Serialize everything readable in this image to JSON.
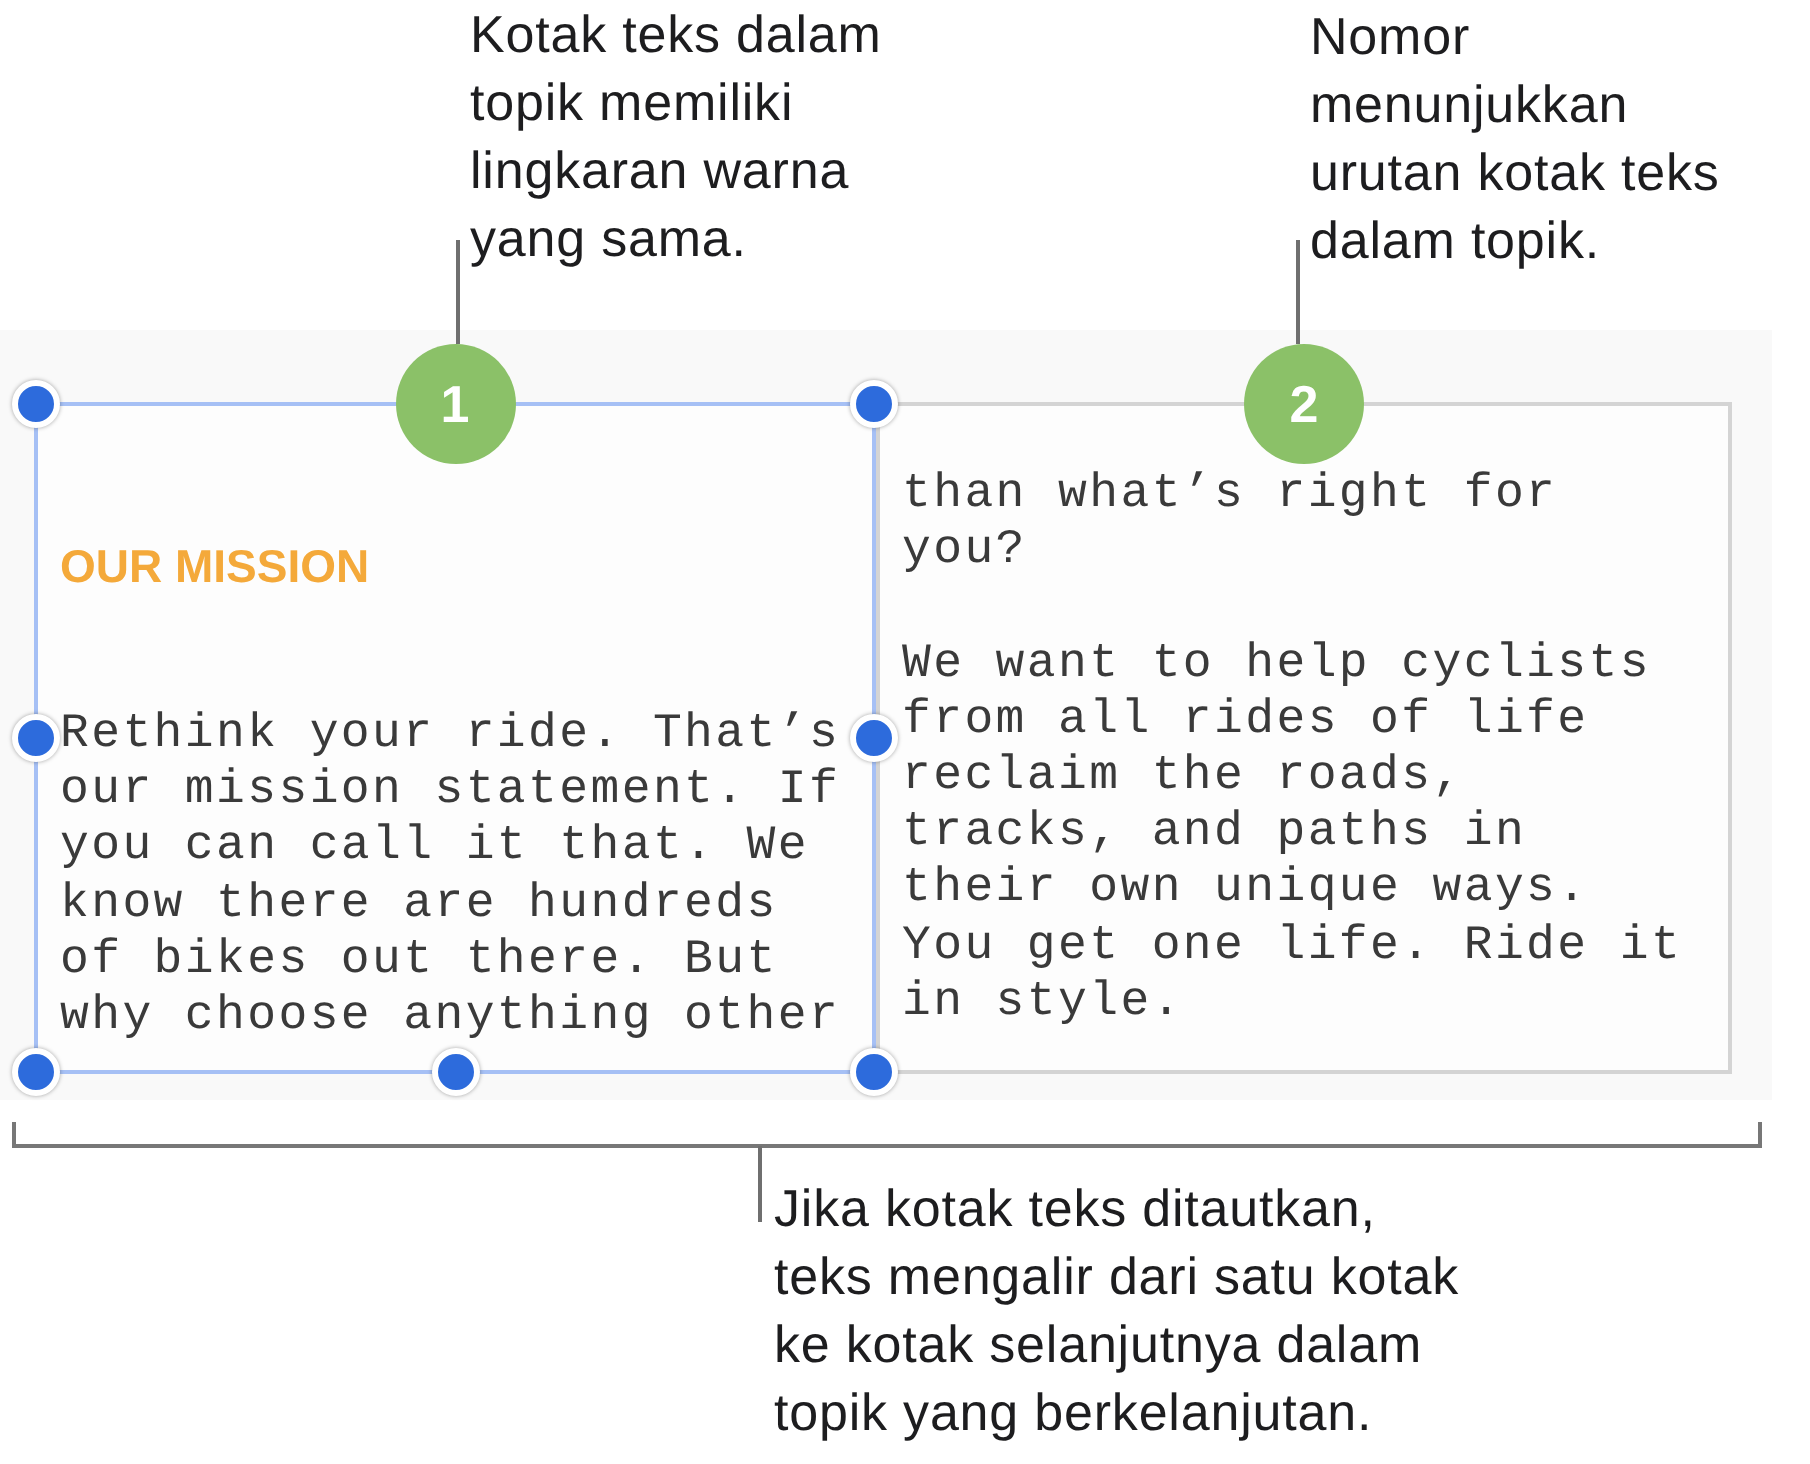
{
  "callouts": [
    {
      "lines": [
        "Kotak teks dalam",
        "topik memiliki",
        "lingkaran warna",
        "yang sama."
      ]
    },
    {
      "lines": [
        "Nomor",
        "menunjukkan",
        "urutan kotak teks",
        "dalam topik."
      ]
    },
    {
      "lines": [
        "Jika kotak teks ditautkan,",
        "teks mengalir dari satu kotak",
        "ke kotak selanjutnya dalam",
        "topik yang berkelanjutan."
      ]
    }
  ],
  "text_boxes": [
    {
      "selected": true,
      "order": "1",
      "color": "#8bc168",
      "heading": "OUR MISSION",
      "paragraphs": [
        "Rethink your ride. That’s our mission statement. If you can call it that. We know there are hundreds of bikes out there. But why choose anything other"
      ]
    },
    {
      "selected": false,
      "order": "2",
      "color": "#8bc168",
      "paragraphs": [
        "than what’s right for you?",
        "We want to help cyclists from all rides of life reclaim the roads, tracks, and paths in their own unique ways. You get one life. Ride it in style."
      ]
    }
  ]
}
